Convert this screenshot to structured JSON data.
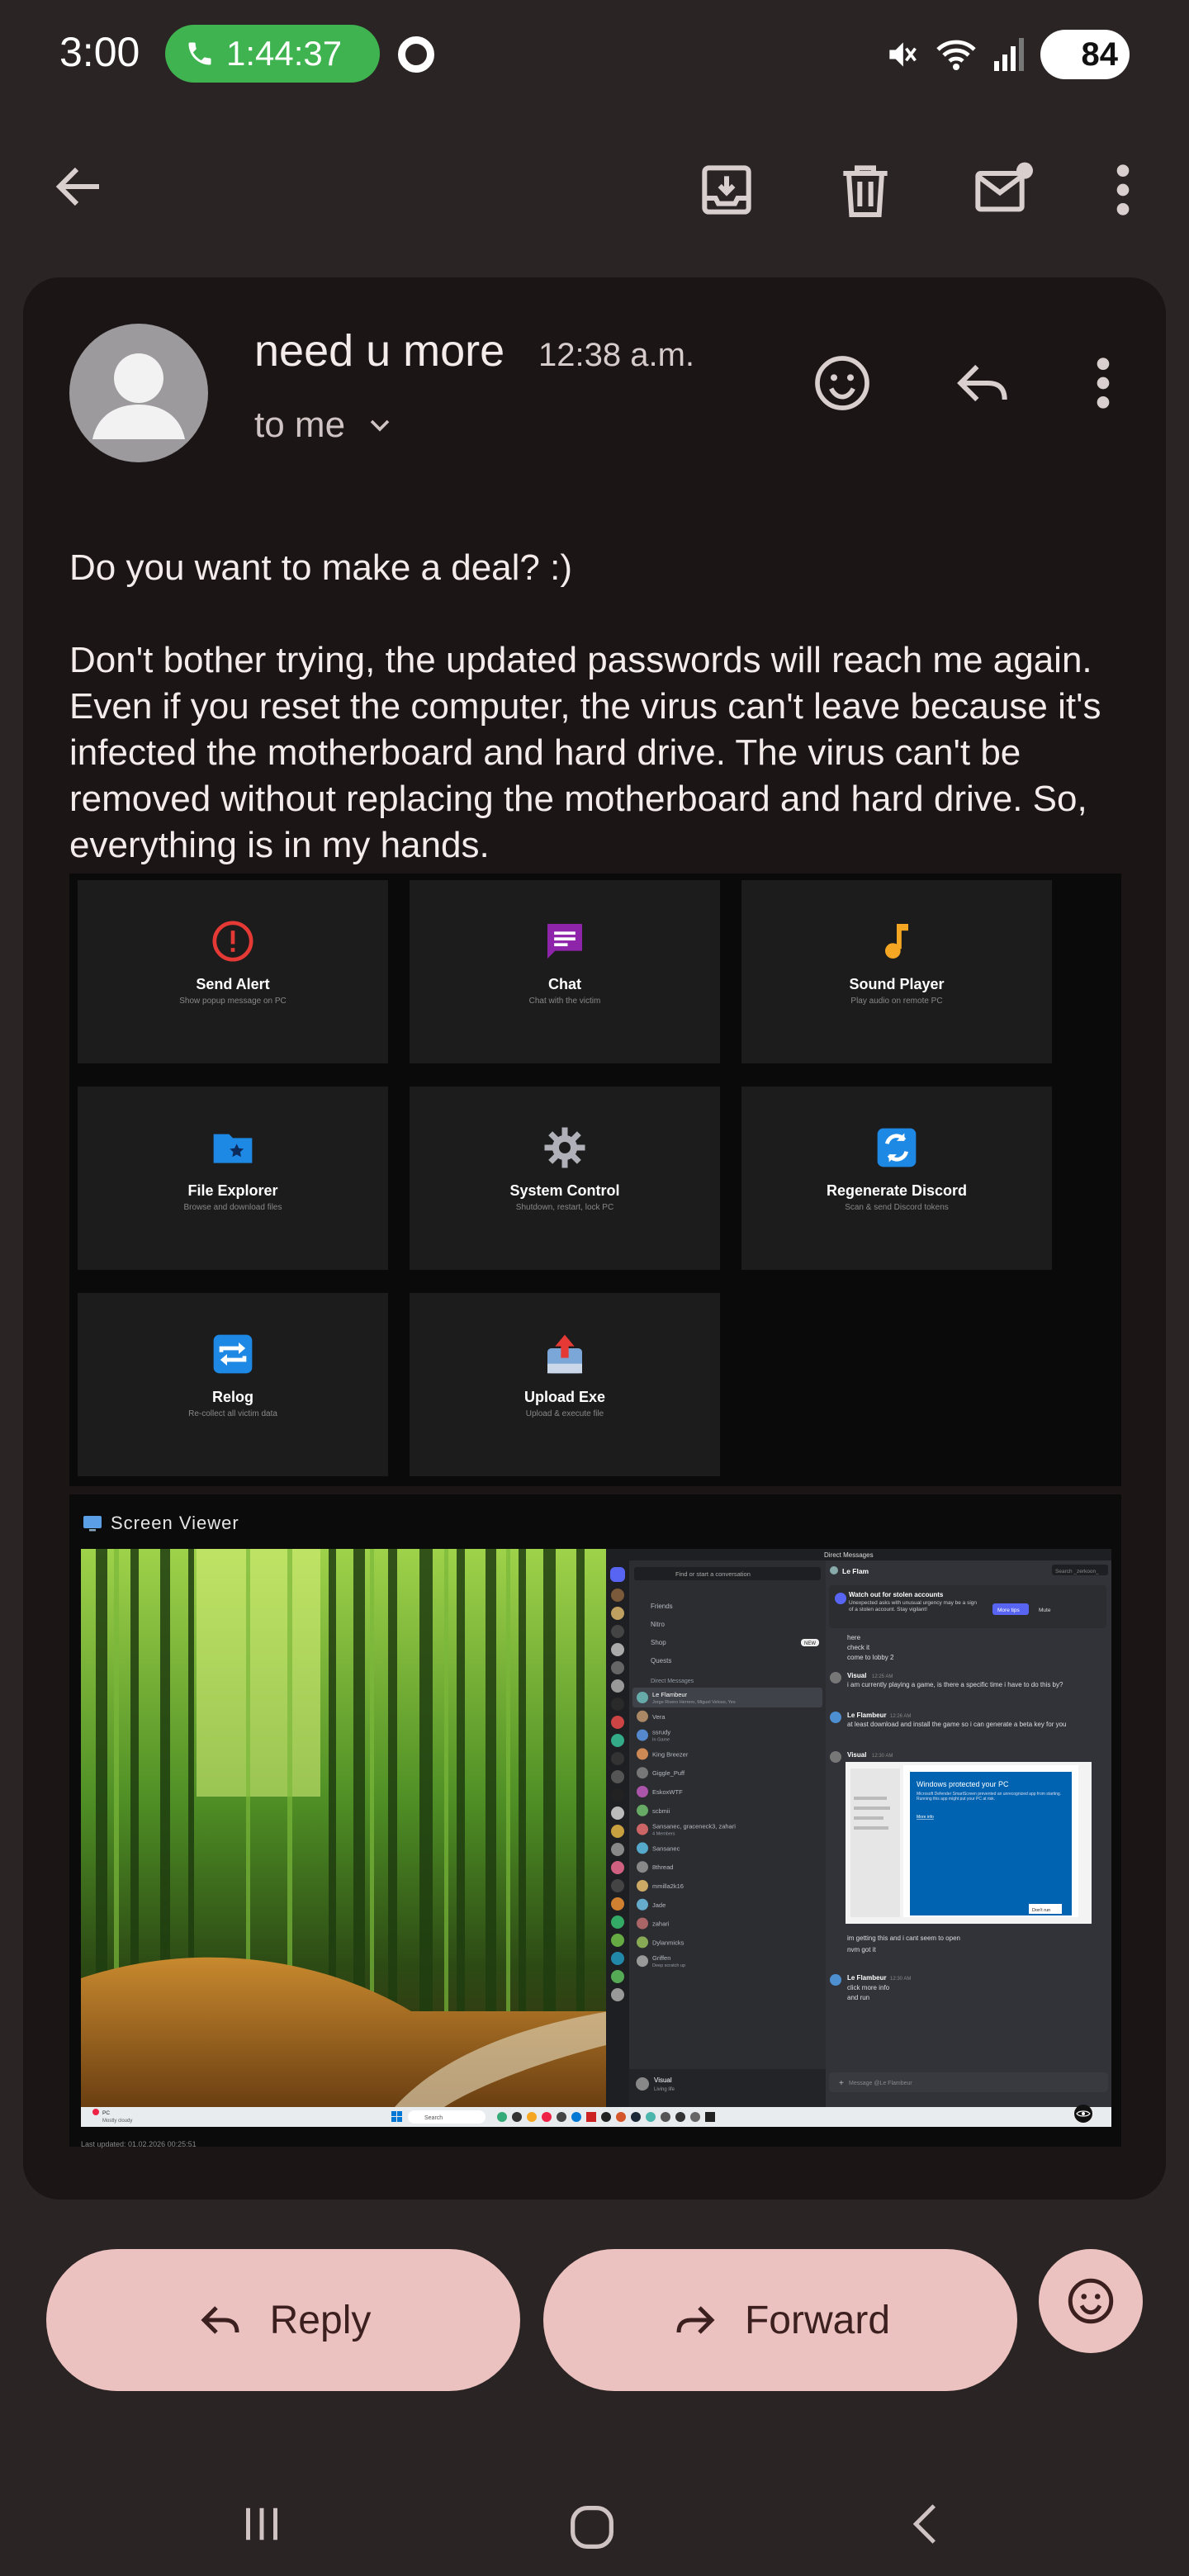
{
  "status_bar": {
    "clock": "3:00",
    "call_timer": "1:44:37",
    "battery": "84"
  },
  "email": {
    "subject": "need u more",
    "time": "12:38 a.m.",
    "recipient": "to me",
    "body": [
      "Do you want to make a deal? :)",
      "Don't bother trying, the updated passwords will reach me again. Even if you reset the computer, the virus can't leave because it's infected the motherboard and hard drive. The virus can't be removed without replacing the motherboard and hard drive. So, everything is in my hands."
    ]
  },
  "dashboard": {
    "tiles": [
      {
        "title": "Send Alert",
        "desc": "Show popup message on PC",
        "icon": "alert-icon",
        "color": "#e53935"
      },
      {
        "title": "Chat",
        "desc": "Chat with the victim",
        "icon": "chat-icon",
        "color": "#8e24aa"
      },
      {
        "title": "Sound Player",
        "desc": "Play audio on remote PC",
        "icon": "music-note-icon",
        "color": "#f5a623"
      },
      {
        "title": "File Explorer",
        "desc": "Browse and download files",
        "icon": "folder-icon",
        "color": "#1e88e5"
      },
      {
        "title": "System Control",
        "desc": "Shutdown, restart, lock PC",
        "icon": "gear-icon",
        "color": "#9e9e9e"
      },
      {
        "title": "Regenerate Discord",
        "desc": "Scan & send Discord tokens",
        "icon": "refresh-icon",
        "color": "#1e88e5"
      },
      {
        "title": "Relog",
        "desc": "Re-collect all victim data",
        "icon": "repeat-icon",
        "color": "#1e88e5"
      },
      {
        "title": "Upload Exe",
        "desc": "Upload & execute file",
        "icon": "upload-icon",
        "color": "#e53935"
      }
    ]
  },
  "viewer": {
    "title": "Screen Viewer",
    "discord": {
      "window_title": "Direct Messages",
      "search_conv": "Find or start a conversation",
      "search": "Search _zerkoon_",
      "server": "Le Flam",
      "nav": [
        "Friends",
        "Nitro",
        "Shop",
        "Quests"
      ],
      "shop_badge": "NEW",
      "dm_header": "Direct Messages",
      "dms": [
        {
          "name": "Le Flambeur",
          "sub": "Jorge Rivero Herrero, Miguel Veloso, Yes"
        },
        {
          "name": "Vera",
          "sub": ""
        },
        {
          "name": "ssrudy",
          "sub": "In Game"
        },
        {
          "name": "King Breezer",
          "sub": ""
        },
        {
          "name": "Giggle_Puff",
          "sub": ""
        },
        {
          "name": "EskoxWTF",
          "sub": ""
        },
        {
          "name": "scbmii",
          "sub": ""
        },
        {
          "name": "Sansanec, graceneck3, zahari",
          "sub": "4 Members"
        },
        {
          "name": "Sansanec",
          "sub": ""
        },
        {
          "name": "8thread",
          "sub": ""
        },
        {
          "name": "mmilla2k16",
          "sub": ""
        },
        {
          "name": "Jade",
          "sub": ""
        },
        {
          "name": "zahari",
          "sub": ""
        },
        {
          "name": "Dylanmicks",
          "sub": ""
        },
        {
          "name": "Griffen",
          "sub": "Deep scratch up"
        }
      ],
      "user": {
        "name": "Visual",
        "status": "Living life"
      },
      "banner": {
        "title": "Watch out for stolen accounts",
        "text": "Unexpected asks with unusual urgency may be a sign of a stolen account. Stay vigilant!",
        "btn1": "More tips",
        "btn2": "Mute"
      },
      "messages": [
        {
          "lines": [
            "here",
            "check it",
            "come to lobby 2"
          ]
        },
        {
          "author": "Visual",
          "time": "12:25 AM",
          "lines": [
            "i am currently playing a game, is there a specific time i have to do this by?"
          ]
        },
        {
          "author": "Le Flambeur",
          "time": "12:26 AM",
          "lines": [
            "at least download and install the game so i can generate a beta key for you"
          ]
        },
        {
          "author": "Visual",
          "time": "12:30 AM",
          "lines": []
        },
        {
          "lines": [
            "im getting this and i cant seem to open",
            "nvm got it"
          ]
        },
        {
          "author": "Le Flambeur",
          "time": "12:30 AM",
          "lines": [
            "click more info",
            "and run"
          ]
        }
      ],
      "smartscreen": {
        "title": "Windows protected your PC",
        "text": "Microsoft Defender SmartScreen prevented an unrecognized app from starting. Running this app might put your PC at risk.",
        "link": "More info",
        "button": "Don't run"
      },
      "composer": "Message @Le Flambeur"
    },
    "taskbar": {
      "weather_temp": "PC",
      "weather_desc": "Mostly cloudy",
      "search": "Search"
    },
    "last_updated": "Last updated: 01.02.2026 00:25:51"
  },
  "actions": {
    "reply": "Reply",
    "forward": "Forward"
  },
  "colors": {
    "background": "#2b2424",
    "card": "#1b1515",
    "pill": "#ecc2c0",
    "call_green": "#3fb34f"
  }
}
